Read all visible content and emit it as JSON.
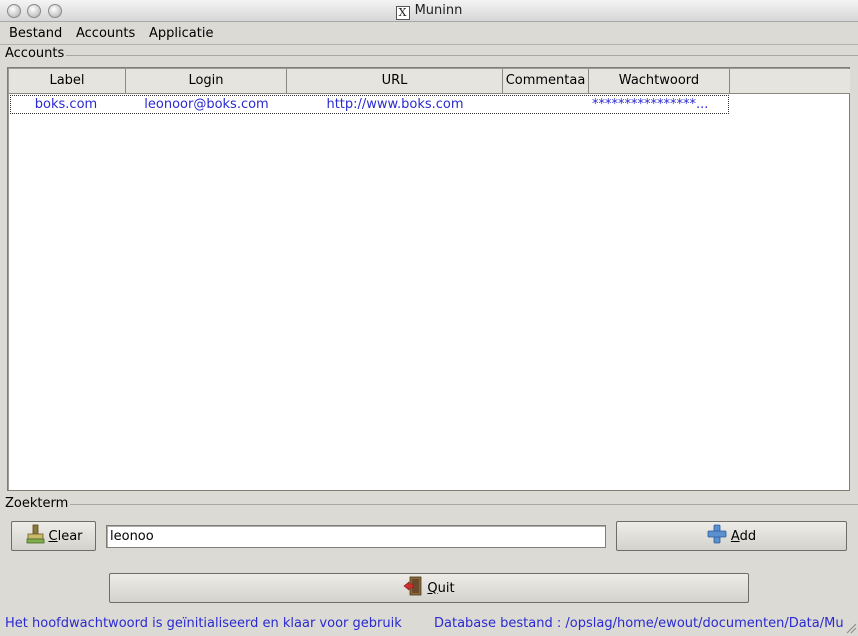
{
  "window": {
    "title": "Muninn"
  },
  "menu": {
    "items": [
      "Bestand",
      "Accounts",
      "Applicatie"
    ]
  },
  "accounts_group": {
    "label": "Accounts"
  },
  "table": {
    "columns": [
      "Label",
      "Login",
      "URL",
      "Commentaa",
      "Wachtwoord"
    ],
    "rows": [
      {
        "label": "boks.com",
        "login": "leonoor@boks.com",
        "url": "http://www.boks.com",
        "comment": "",
        "password": "****************..."
      }
    ]
  },
  "search_group": {
    "label": "Zoekterm"
  },
  "search": {
    "value": "leonoo"
  },
  "buttons": {
    "clear_mnemonic": "C",
    "clear_rest": "lear",
    "add_mnemonic": "A",
    "add_rest": "dd",
    "quit_mnemonic": "Q",
    "quit_rest": "uit"
  },
  "status": {
    "left": "Het hoofdwachtwoord is geïnitialiseerd en klaar voor gebruik",
    "right": "Database bestand : /opslag/home/ewout/documenten/Data/Mun"
  },
  "icons": {
    "clear": "broom-icon",
    "add": "plus-icon",
    "quit": "exit-door-icon"
  }
}
